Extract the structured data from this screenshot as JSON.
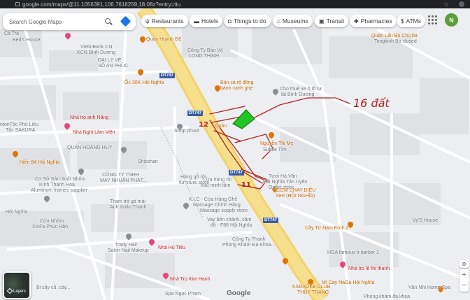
{
  "browser": {
    "url": "google.com/maps/@11.1056391,106.7618259,18.08z?entry=ttu"
  },
  "search": {
    "placeholder": "Search Google Maps"
  },
  "chips": [
    {
      "icon": "fork-knife-icon",
      "label": "Restaurants"
    },
    {
      "icon": "bed-icon",
      "label": "Hotels"
    },
    {
      "icon": "camera-icon",
      "label": "Things to do"
    },
    {
      "icon": "museum-icon",
      "label": "Museums"
    },
    {
      "icon": "bus-icon",
      "label": "Transit"
    },
    {
      "icon": "pill-icon",
      "label": "Pharmacies"
    },
    {
      "icon": "atm-icon",
      "label": "ATMs"
    }
  ],
  "user": {
    "avatar_letter": "N"
  },
  "layers": {
    "label": "Layers"
  },
  "logo": {
    "text": "Google"
  },
  "roads": {
    "badge": "DT747"
  },
  "annotations": {
    "label": "16 đất",
    "num_12": "12",
    "num_11": "11"
  },
  "places": [
    {
      "text": "Cà Tra",
      "color": "gray"
    },
    {
      "text": "Bed's House",
      "color": "gray"
    },
    {
      "text": "VietinBank CN",
      "color": "gray"
    },
    {
      "text": "KCN Bình Dương",
      "color": "gray"
    },
    {
      "text": "ĐẠI LÝ VÉ",
      "color": "gray"
    },
    {
      "text": "SỐ AN PHÚC",
      "color": "gray"
    },
    {
      "text": "Quán Huỳnh Đệ",
      "color": "orange"
    },
    {
      "text": "Công Ty Bảo Vệ",
      "color": "gray"
    },
    {
      "text": "LONG THỊNH",
      "color": "gray"
    },
    {
      "text": "Ốc 30K Hội Nghĩa",
      "color": "orange"
    },
    {
      "text": "Bún cá rô đồng",
      "color": "orange"
    },
    {
      "text": "bánh canh ghẹ",
      "color": "orange"
    },
    {
      "text": "Cho thuê xe ô tô tự",
      "color": "gray"
    },
    {
      "text": "lái Bình Dương",
      "color": "gray"
    },
    {
      "text": "Nhà trọ anh Năng",
      "color": "pink"
    },
    {
      "text": "ntonTộc Phú Liêu",
      "color": "gray"
    },
    {
      "text": "Tộc SAKURA",
      "color": "gray"
    },
    {
      "text": "Nhà Nghỉ Lâm Viên",
      "color": "pink"
    },
    {
      "text": "Shop phuot",
      "color": "gray"
    },
    {
      "text": "Quán",
      "color": "orange"
    },
    {
      "text": "Nguyễn Thị Mẹ",
      "color": "orange"
    },
    {
      "text": "Subtle Tìm",
      "color": "gray"
    },
    {
      "text": "QUÁN HOÀNG HUY",
      "color": "gray"
    },
    {
      "text": "Hiền 84 Hội Nghĩa",
      "color": "orange"
    },
    {
      "text": "Shisshan",
      "color": "gray"
    },
    {
      "text": "CÔNG TY TNHH",
      "color": "gray"
    },
    {
      "text": "MAY NHUẬN PHÁT...",
      "color": "gray"
    },
    {
      "text": "Cửa hàng rõi",
      "color": "gray"
    },
    {
      "text": "thất minh tâm",
      "color": "gray"
    },
    {
      "text": "Hãng gỗ rõi",
      "color": "gray"
    },
    {
      "text": "furniture store",
      "color": "gray"
    },
    {
      "text": "Tươi Hà Văn",
      "color": "gray"
    },
    {
      "text": "Hội Nghĩa Tân Uyên",
      "color": "gray"
    },
    {
      "text": "Outlet store",
      "color": "gray"
    },
    {
      "text": "Cơ Sở Sản Xuất Nhôm",
      "color": "gray"
    },
    {
      "text": "Kính Thanh Hòa",
      "color": "gray"
    },
    {
      "text": "Aluminum frames supplier",
      "color": "gray"
    },
    {
      "text": "Tham trà gà mái",
      "color": "gray"
    },
    {
      "text": "Anh Xuân Thanh",
      "color": "gray"
    },
    {
      "text": "K.I.C - Cửa Hàng Ghế",
      "color": "gray"
    },
    {
      "text": "Massage Chính Hãng",
      "color": "gray"
    },
    {
      "text": "Massage supply store",
      "color": "gray"
    },
    {
      "text": "CƠM CHAY DIỆU",
      "color": "orange"
    },
    {
      "text": "NHI (HỘI NGHĨA)",
      "color": "orange"
    },
    {
      "text": "Quán Lẩu Bò Chú ba",
      "color": "orange"
    },
    {
      "text": "Tongkinh Bò closed",
      "color": "gray"
    },
    {
      "text": "Hội Nghĩa",
      "color": "gray"
    },
    {
      "text": "Cửa Nhôm",
      "color": "gray"
    },
    {
      "text": "XinFa Phúc Hân",
      "color": "gray"
    },
    {
      "text": "Vay bến chành, cầm",
      "color": "gray"
    },
    {
      "text": "đồ - F88 Hội Nghĩa",
      "color": "gray"
    },
    {
      "text": "Cây Tơ Nam Đình 2",
      "color": "orange"
    },
    {
      "text": "Vy'S House",
      "color": "gray"
    },
    {
      "text": "Trady Hair",
      "color": "gray"
    },
    {
      "text": "Salon Nail Makeup",
      "color": "gray"
    },
    {
      "text": "Nhà Hủ Tiếu",
      "color": "pink"
    },
    {
      "text": "Phòng Khám Đa Khoa...",
      "color": "gray"
    },
    {
      "text": "Công Ty Thanh",
      "color": "gray"
    },
    {
      "text": "HOA famous tr barber 1",
      "color": "gray"
    },
    {
      "text": "Nhà trọ lê thi thanh",
      "color": "pink"
    },
    {
      "text": "Nhà Trọ Kim Hạnh",
      "color": "pink"
    },
    {
      "text": "Bi cây cũ, cây...",
      "color": "gray"
    },
    {
      "text": "Spa Ngọc Phạm",
      "color": "gray"
    },
    {
      "text": "KARAOKE CLUB",
      "color": "orange"
    },
    {
      "text": "THÙY TRANG",
      "color": "orange"
    },
    {
      "text": "Mì Cay NaGa Hội Nghĩa",
      "color": "orange"
    },
    {
      "text": "Phòng khám đa khoa",
      "color": "gray"
    },
    {
      "text": "Vân Nhi Home Spa",
      "color": "gray"
    }
  ]
}
